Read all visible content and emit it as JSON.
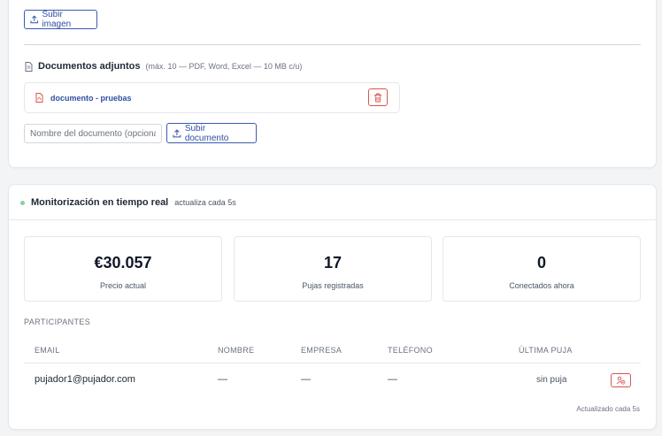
{
  "upload": {
    "image_button_label": "Subir imagen"
  },
  "documents": {
    "title": "Documentos adjuntos",
    "hint": "(máx. 10 — PDF, Word, Excel — 10 MB c/u)",
    "items": [
      {
        "name": "documento - pruebas",
        "icon": "pdf-file-icon"
      }
    ],
    "name_input_placeholder": "Nombre del documento (opcional)",
    "upload_button_label": "Subir documento"
  },
  "monitoring": {
    "title": "Monitorización en tiempo real",
    "subtitle": "actualiza cada 5s",
    "stats": {
      "price": {
        "value": "€30.057",
        "label": "Precio actual"
      },
      "bids": {
        "value": "17",
        "label": "Pujas registradas"
      },
      "online": {
        "value": "0",
        "label": "Conectados ahora"
      }
    },
    "participants_label": "PARTICIPANTES",
    "columns": [
      "EMAIL",
      "NOMBRE",
      "EMPRESA",
      "TELÉFONO",
      "ÚLTIMA PUJA"
    ],
    "rows": [
      {
        "email": "pujador1@pujador.com",
        "nombre": "—",
        "empresa": "—",
        "telefono": "—",
        "ultima_puja": "sin puja"
      }
    ],
    "footer": "Actualizado cada 5s"
  },
  "colors": {
    "accent": "#2f4fa3",
    "danger": "#d9534f",
    "live": "#86d1a3"
  }
}
